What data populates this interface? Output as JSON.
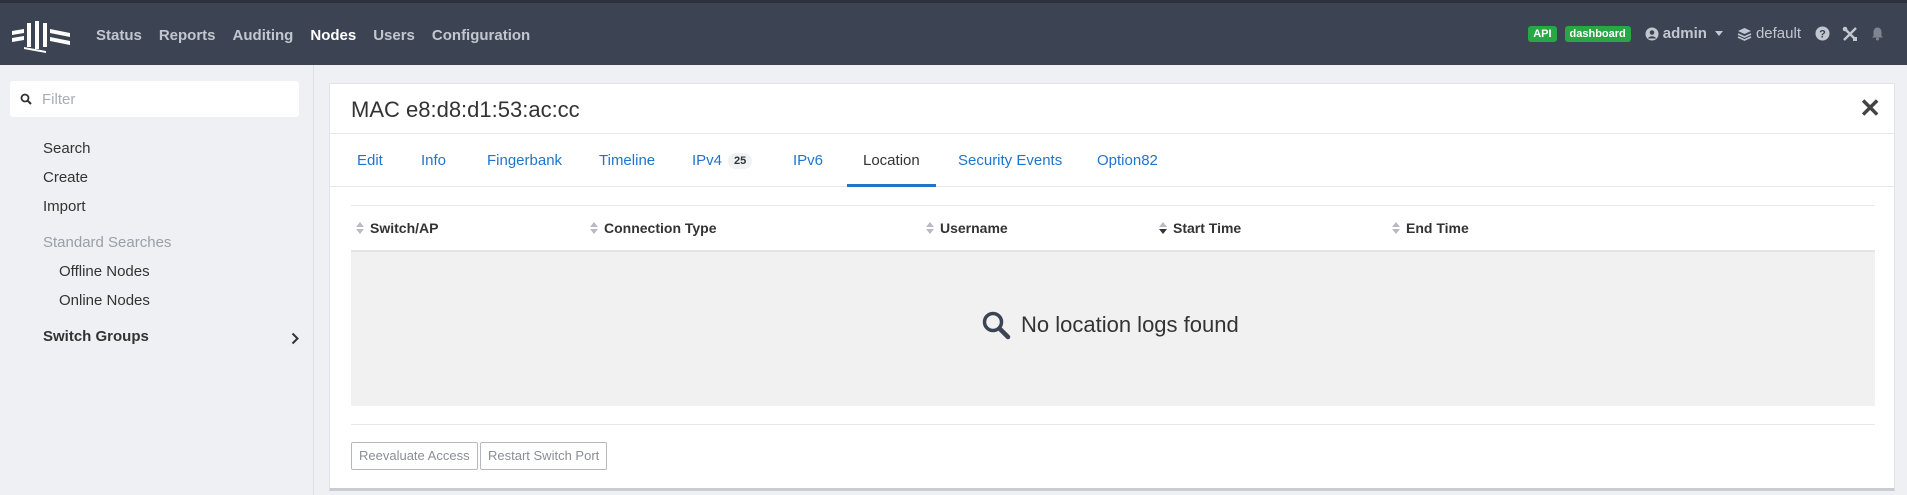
{
  "nav": {
    "items": [
      "Status",
      "Reports",
      "Auditing",
      "Nodes",
      "Users",
      "Configuration"
    ],
    "active": "Nodes"
  },
  "toolbar": {
    "api_badge": "API",
    "dashboard_badge": "dashboard",
    "user": "admin",
    "tenant": "default"
  },
  "sidebar": {
    "filter_placeholder": "Filter",
    "items": [
      "Search",
      "Create",
      "Import"
    ],
    "standard_searches_heading": "Standard Searches",
    "searches": [
      "Offline Nodes",
      "Online Nodes"
    ],
    "group": "Switch Groups"
  },
  "card": {
    "title": "MAC e8:d8:d1:53:ac:cc",
    "tabs": [
      {
        "label": "Edit"
      },
      {
        "label": "Info"
      },
      {
        "label": "Fingerbank"
      },
      {
        "label": "Timeline"
      },
      {
        "label": "IPv4",
        "count": "25"
      },
      {
        "label": "IPv6"
      },
      {
        "label": "Location"
      },
      {
        "label": "Security Events"
      },
      {
        "label": "Option82"
      }
    ],
    "active_tab": "Location",
    "columns": [
      "Switch/AP",
      "Connection Type",
      "Username",
      "Start Time",
      "End Time"
    ],
    "sorted_column": "Start Time",
    "empty_message": "No location logs found",
    "buttons": {
      "reevaluate": "Reevaluate Access",
      "restart": "Restart Switch Port"
    }
  },
  "colors": {
    "topbar": "#3c4454",
    "link": "#1f75cc",
    "badge": "#28a745"
  }
}
